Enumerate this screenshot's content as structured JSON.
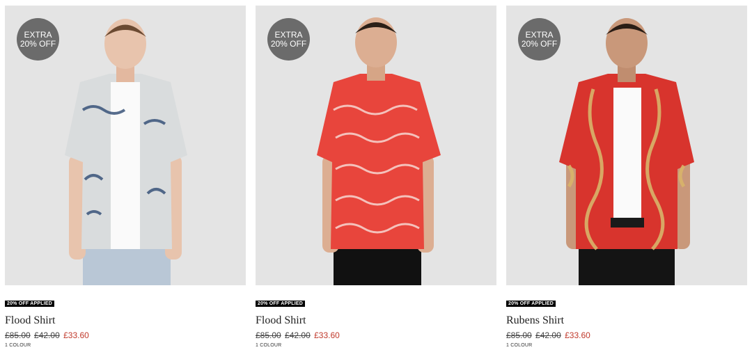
{
  "products": [
    {
      "promo_line1": "EXTRA",
      "promo_line2": "20% OFF",
      "tag": "20% OFF APPLIED",
      "name": "Flood Shirt",
      "price_original": "£85.00",
      "price_previous": "£42.00",
      "price_current": "£33.60",
      "colours": "1 COLOUR",
      "shirt_color": "#d9dcdd",
      "pattern_color": "#2f4a73",
      "trouser_color": "#b9c7d6"
    },
    {
      "promo_line1": "EXTRA",
      "promo_line2": "20% OFF",
      "tag": "20% OFF APPLIED",
      "name": "Flood Shirt",
      "price_original": "£85.00",
      "price_previous": "£42.00",
      "price_current": "£33.60",
      "colours": "1 COLOUR",
      "shirt_color": "#e8453c",
      "pattern_color": "#f7d7d2",
      "trouser_color": "#111111"
    },
    {
      "promo_line1": "EXTRA",
      "promo_line2": "20% OFF",
      "tag": "20% OFF APPLIED",
      "name": "Rubens Shirt",
      "price_original": "£85.00",
      "price_previous": "£42.00",
      "price_current": "£33.60",
      "colours": "1 COLOUR",
      "shirt_color": "#d8342d",
      "pattern_color": "#d9b46a",
      "trouser_color": "#141414"
    }
  ]
}
